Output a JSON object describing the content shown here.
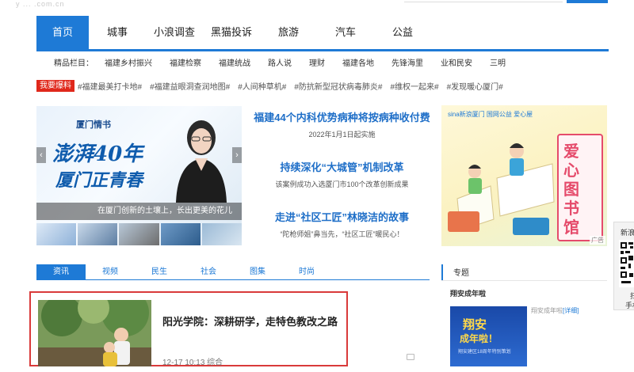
{
  "header": {
    "logo_remnant": "y   ...   .com.cn"
  },
  "main_nav": [
    {
      "label": "首页",
      "active": true
    },
    {
      "label": "城事"
    },
    {
      "label": "小浪调查"
    },
    {
      "label": "黑猫投诉"
    },
    {
      "label": "旅游"
    },
    {
      "label": "汽车"
    },
    {
      "label": "公益"
    }
  ],
  "subbar": {
    "lead": "精品栏目：",
    "items": [
      "福建乡村振兴",
      "福建检察",
      "福建统战",
      "路人说",
      "理财",
      "福建各地",
      "先锋海里",
      "业和民安",
      "三明"
    ]
  },
  "hotline": {
    "badge": "我要爆料",
    "tags": [
      "#福建最美打卡地#",
      "#福建益眼洞查润地图#",
      "#人间种草机#",
      "#防抗新型冠状病毒肺炎#",
      "#维权一起来#",
      "#发现暖心厦门#"
    ]
  },
  "slider": {
    "brand": "厦门情书",
    "title_line1": "澎湃40年",
    "title_line2": "厦门正青春",
    "caption": "在厦门创新的土壤上，长出更美的花儿",
    "prev": "‹",
    "next": "›"
  },
  "headlines": [
    {
      "title": "福建44个内科优势病种将按病种收付费",
      "summary": "2022年1月1日起实施"
    },
    {
      "title": "持续深化“大城管”机制改革",
      "summary": "该案例成功入选厦门市100个改革创新成果"
    },
    {
      "title": "走进“社区工匠”林晓洁的故事",
      "summary": "“陀枪师姐”鼻当先，“社区工匠”暖民心！"
    }
  ],
  "ad": {
    "logos": "sina新浪厦门   国网公益   爱心屋",
    "chars": [
      "爱",
      "心",
      "图",
      "书",
      "馆"
    ],
    "tag": "广告"
  },
  "tabs": [
    {
      "label": "资讯",
      "active": true
    },
    {
      "label": "视频"
    },
    {
      "label": "民生"
    },
    {
      "label": "社会"
    },
    {
      "label": "图集"
    },
    {
      "label": "时尚"
    }
  ],
  "article": {
    "title": "阳光学院：深耕研学，走特色教改之路",
    "time": "12-17 10:13",
    "category": "综合"
  },
  "right_column": {
    "title": "专题",
    "special_title": "翔安成年啦",
    "special_img_line1": "翔安",
    "special_img_line2": "成年啦！",
    "special_img_line3": "翔安建区18周年特别策划",
    "special_desc": "翔安成年啦",
    "special_link": "[详细]"
  },
  "qr_panel": {
    "top": "新浪",
    "bottom1": "扫",
    "bottom2": "手机"
  },
  "colors": {
    "brand_blue": "#1e7ad6",
    "hot_red": "#e0281b",
    "highlight_border": "#d93a3a"
  }
}
